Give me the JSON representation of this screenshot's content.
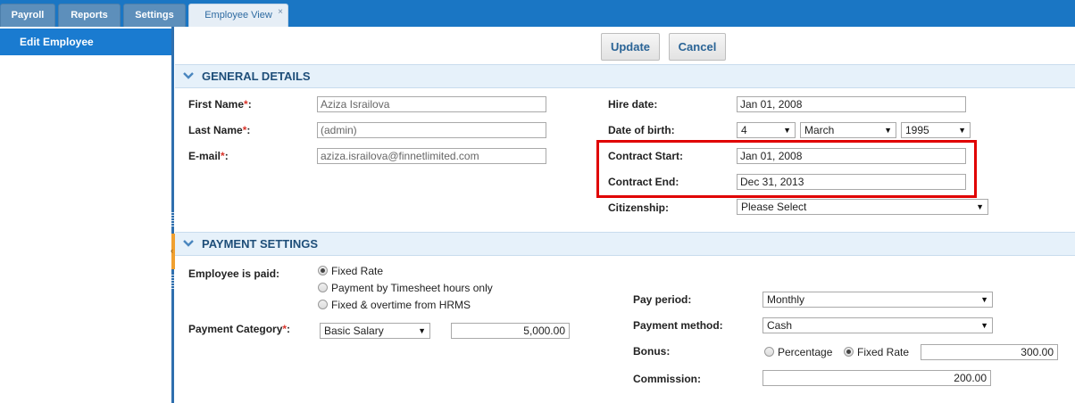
{
  "tabs": [
    {
      "label": "Payroll"
    },
    {
      "label": "Reports"
    },
    {
      "label": "Settings"
    },
    {
      "label": "Employee View",
      "close": "×"
    }
  ],
  "sidebar": {
    "items": [
      {
        "label": "Edit Employee"
      }
    ]
  },
  "toolbar": {
    "update_label": "Update",
    "cancel_label": "Cancel"
  },
  "general": {
    "title": "GENERAL DETAILS",
    "first_name_label": "First Name",
    "last_name_label": "Last Name",
    "email_label": "E-mail",
    "required_mark": "*",
    "label_colon": ":",
    "first_name": "Aziza Israilova",
    "last_name": "(admin)",
    "email": "aziza.israilova@finnetlimited.com",
    "hire_date_label": "Hire date:",
    "hire_date": "Jan 01, 2008",
    "dob_label": "Date of birth:",
    "dob_day": "4",
    "dob_month": "March",
    "dob_year": "1995",
    "contract_start_label": "Contract Start:",
    "contract_start": "Jan 01, 2008",
    "contract_end_label": "Contract End:",
    "contract_end": "Dec 31, 2013",
    "citizenship_label": "Citizenship:",
    "citizenship": "Please Select"
  },
  "payment": {
    "title": "PAYMENT SETTINGS",
    "paid_label": "Employee is paid:",
    "paid_options": [
      "Fixed Rate",
      "Payment by Timesheet hours only",
      "Fixed & overtime from HRMS"
    ],
    "paid_selected": "Fixed Rate",
    "category_label": "Payment Category",
    "category": "Basic Salary",
    "category_amount": "5,000.00",
    "pay_period_label": "Pay period:",
    "pay_period": "Monthly",
    "method_label": "Payment method:",
    "method": "Cash",
    "bonus_label": "Bonus:",
    "bonus_options": [
      "Percentage",
      "Fixed Rate"
    ],
    "bonus_selected": "Fixed Rate",
    "bonus_amount": "300.00",
    "commission_label": "Commission:",
    "commission": "200.00"
  },
  "icons": {
    "chevron": "chevron-down-icon",
    "caret": "dropdown-caret-icon",
    "close": "close-icon"
  },
  "colors": {
    "tabbar": "#1a76c4",
    "sidebar_active": "#1a7bd0",
    "highlight": "#e00000",
    "required": "#d9342b"
  }
}
